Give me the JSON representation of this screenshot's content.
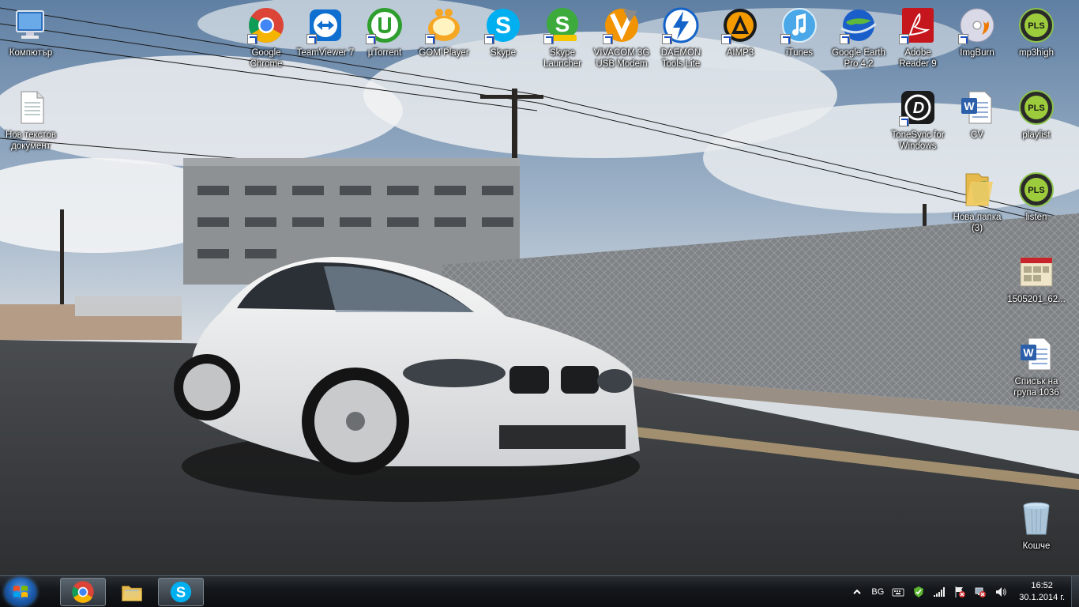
{
  "desktop": {
    "icons": [
      {
        "label": "Компютър",
        "icon": "computer-icon"
      },
      {
        "label": "Нов текстов документ",
        "icon": "text-document-icon"
      },
      {
        "label": "Google Chrome",
        "icon": "chrome-icon"
      },
      {
        "label": "TeamViewer 7",
        "icon": "teamviewer-icon"
      },
      {
        "label": "µTorrent",
        "icon": "utorrent-icon"
      },
      {
        "label": "GOM Player",
        "icon": "gom-player-icon"
      },
      {
        "label": "Skype",
        "icon": "skype-icon"
      },
      {
        "label": "Skype Launcher",
        "icon": "skype-launcher-icon"
      },
      {
        "label": "VIVACOM 3G USB Modem",
        "icon": "vivacom-icon"
      },
      {
        "label": "DAEMON Tools Lite",
        "icon": "daemon-tools-icon"
      },
      {
        "label": "AIMP3",
        "icon": "aimp-icon"
      },
      {
        "label": "iTunes",
        "icon": "itunes-icon"
      },
      {
        "label": "Google Earth Pro 4.2",
        "icon": "google-earth-icon"
      },
      {
        "label": "Adobe Reader 9",
        "icon": "adobe-reader-icon"
      },
      {
        "label": "ImgBurn",
        "icon": "imgburn-icon"
      },
      {
        "label": "mp3high",
        "icon": "pls-playlist-icon"
      },
      {
        "label": "ToneSync for Windows",
        "icon": "tonesync-icon"
      },
      {
        "label": "CV",
        "icon": "word-document-icon"
      },
      {
        "label": "playlist",
        "icon": "pls-playlist-icon"
      },
      {
        "label": "Нова папка (3)",
        "icon": "folder-icon"
      },
      {
        "label": "listen",
        "icon": "pls-playlist-icon"
      },
      {
        "label": "1505201_62...",
        "icon": "image-file-icon"
      },
      {
        "label": "Списък на група 1036",
        "icon": "word-document-icon"
      },
      {
        "label": "Кошче",
        "icon": "recycle-bin-icon"
      }
    ]
  },
  "taskbar": {
    "pinned": [
      {
        "name": "Google Chrome",
        "icon": "chrome-icon"
      },
      {
        "name": "Windows Explorer",
        "icon": "explorer-icon"
      },
      {
        "name": "Skype",
        "icon": "skype-icon"
      }
    ],
    "tray": {
      "language": "BG",
      "time": "16:52",
      "date": "30.1.2014 г."
    }
  },
  "colors": {
    "skype": "#00aff0",
    "utorrent": "#2e9f2e",
    "adobe": "#c4161c",
    "pls": "#2a2a2a"
  }
}
